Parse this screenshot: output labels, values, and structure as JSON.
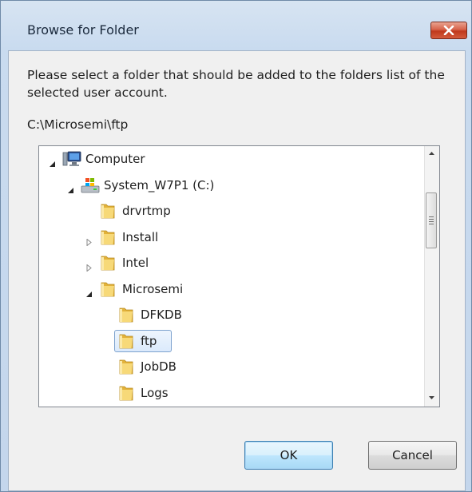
{
  "window": {
    "title": "Browse for Folder",
    "close_icon": "close-icon"
  },
  "message": "Please select a folder that should be added to the folders list of the selected user account.",
  "selected_path": "C:\\Microsemi\\ftp",
  "tree": {
    "items": [
      {
        "label": "Computer",
        "icon": "computer-icon",
        "level": 0,
        "expander": "expanded"
      },
      {
        "label": "System_W7P1 (C:)",
        "icon": "drive-icon",
        "level": 1,
        "expander": "expanded"
      },
      {
        "label": "drvrtmp",
        "icon": "folder-icon",
        "level": 2,
        "expander": "none"
      },
      {
        "label": "Install",
        "icon": "folder-icon",
        "level": 2,
        "expander": "collapsed"
      },
      {
        "label": "Intel",
        "icon": "folder-icon",
        "level": 2,
        "expander": "collapsed"
      },
      {
        "label": "Microsemi",
        "icon": "folder-icon",
        "level": 2,
        "expander": "expanded"
      },
      {
        "label": "DFKDB",
        "icon": "folder-icon",
        "level": 3,
        "expander": "none"
      },
      {
        "label": "ftp",
        "icon": "folder-icon",
        "level": 3,
        "expander": "none",
        "selected": true
      },
      {
        "label": "JobDB",
        "icon": "folder-icon",
        "level": 3,
        "expander": "none"
      },
      {
        "label": "Logs",
        "icon": "folder-icon",
        "level": 3,
        "expander": "none"
      }
    ]
  },
  "buttons": {
    "ok": "OK",
    "cancel": "Cancel"
  },
  "colors": {
    "selection_border": "#7da2ce",
    "folder_yellow": "#f2c94c",
    "close_red": "#c0391c"
  }
}
